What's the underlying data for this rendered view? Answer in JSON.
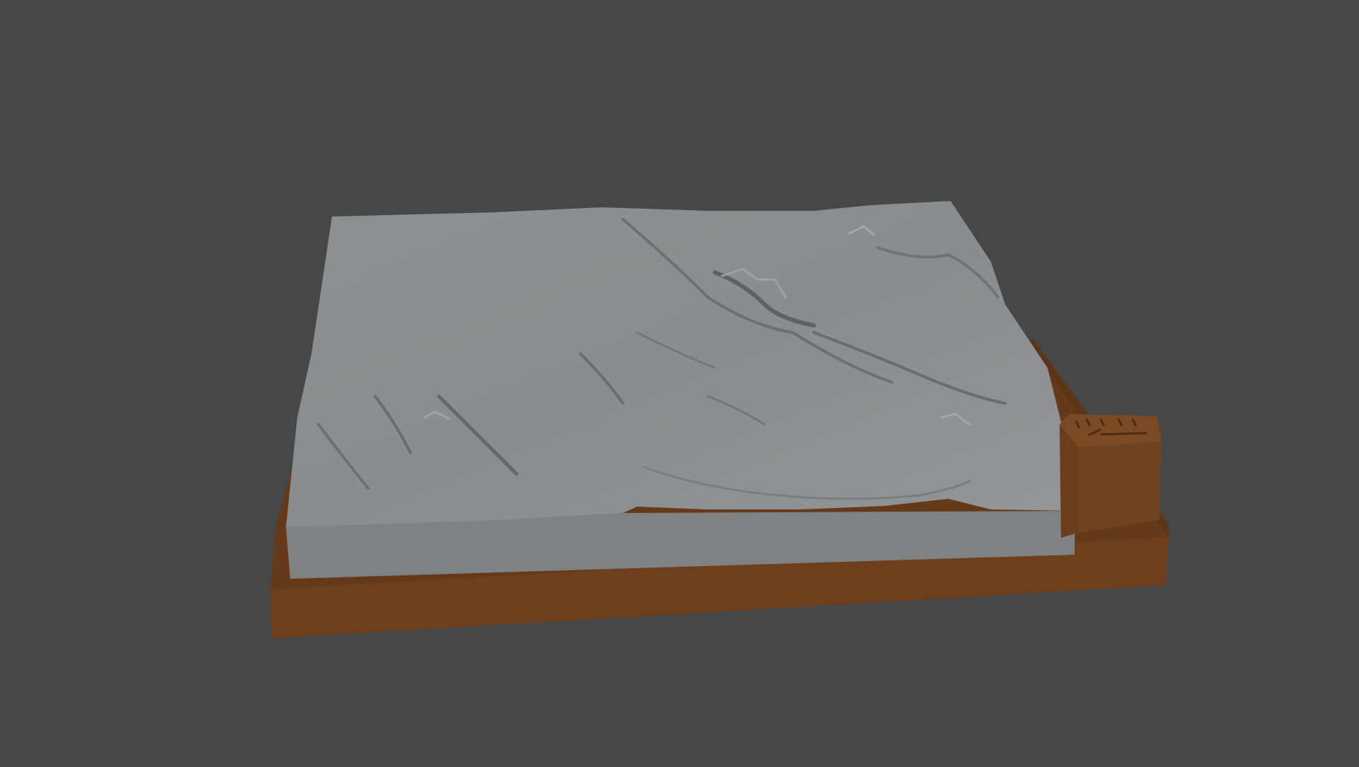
{
  "viewport": {
    "background_color": "#474747",
    "model": {
      "terrain_color": "#8a8c8d",
      "terrain_side_color": "#7e8081",
      "base_color": "#6b3f1e",
      "base_front_color": "#6e3f1c",
      "label_box_color": "#6f4220"
    }
  }
}
